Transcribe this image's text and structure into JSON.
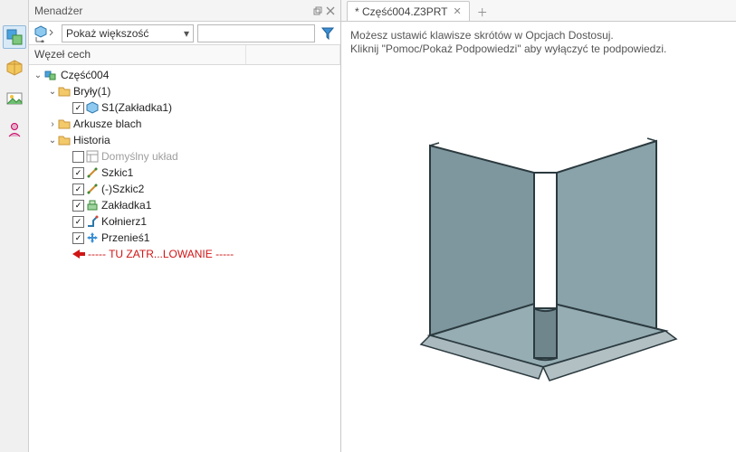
{
  "manager": {
    "title": "Menadżer",
    "combo_label": "Pokaż większość",
    "header_col1": "Węzeł cech",
    "tree": {
      "root": "Część004",
      "solids": {
        "label": "Bryły(1)",
        "child": "S1(Zakładka1)"
      },
      "sheets": "Arkusze blach",
      "history": {
        "label": "Historia",
        "items": [
          {
            "label": "Domyślny układ",
            "checked": false,
            "muted": true,
            "icon": "layout"
          },
          {
            "label": "Szkic1",
            "checked": true,
            "icon": "sketch"
          },
          {
            "label": "(-)Szkic2",
            "checked": true,
            "icon": "sketch"
          },
          {
            "label": "Zakładka1",
            "checked": true,
            "icon": "tab"
          },
          {
            "label": "Kołnierz1",
            "checked": true,
            "icon": "flange"
          },
          {
            "label": "Przenieś1",
            "checked": true,
            "icon": "move"
          }
        ],
        "rollback": "----- TU ZATR...LOWANIE -----"
      }
    }
  },
  "tabs": {
    "active": "* Część004.Z3PRT"
  },
  "hints": {
    "line1": "Możesz ustawić klawisze skrótów w Opcjach Dostosuj.",
    "line2": "Kliknij \"Pomoc/Pokaż Podpowiedzi\" aby wyłączyć te podpowiedzi."
  },
  "icons": {
    "layout": "layout-icon",
    "sketch": "sketch-icon",
    "tab": "tab-icon",
    "flange": "flange-icon",
    "move": "move-icon"
  }
}
